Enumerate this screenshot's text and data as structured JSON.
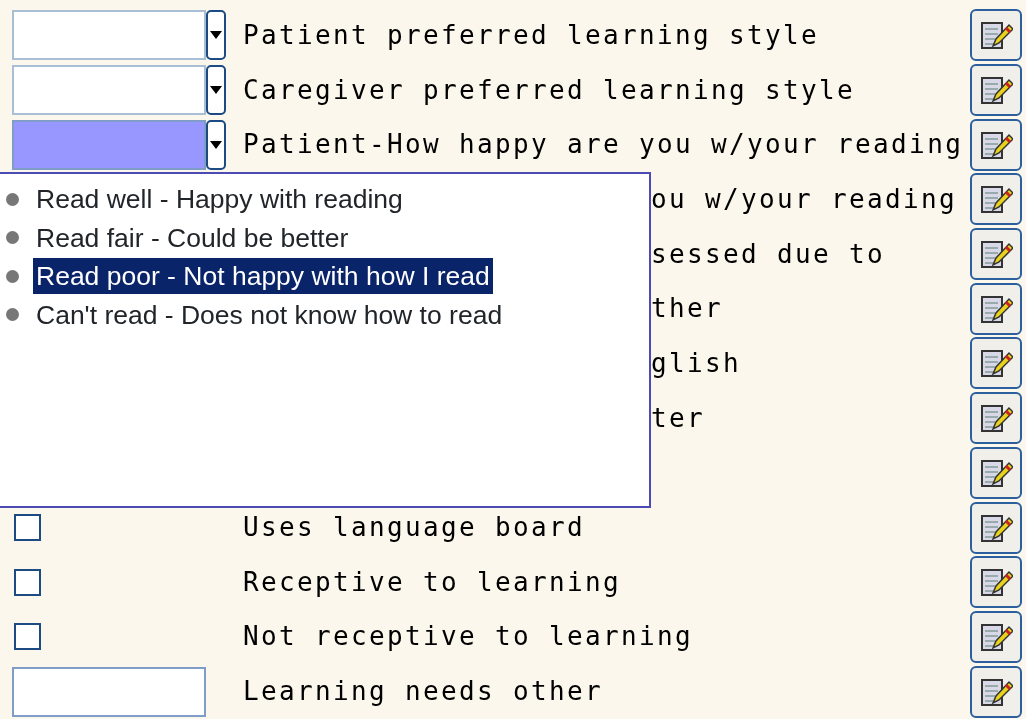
{
  "rows": [
    {
      "kind": "dropdown",
      "label": "Patient preferred learning style",
      "focused": false
    },
    {
      "kind": "dropdown",
      "label": "Caregiver preferred learning style",
      "focused": false
    },
    {
      "kind": "dropdown",
      "label": "Patient-How happy are you w/your reading",
      "focused": true
    },
    {
      "kind": "covered",
      "label": "ou w/your reading"
    },
    {
      "kind": "covered",
      "label": "sessed due to"
    },
    {
      "kind": "covered",
      "label": "ther"
    },
    {
      "kind": "covered",
      "label": "glish"
    },
    {
      "kind": "covered",
      "label": "ter"
    },
    {
      "kind": "covered"
    },
    {
      "kind": "checkbox",
      "label": "Uses language board",
      "checked": false
    },
    {
      "kind": "checkbox",
      "label": "Receptive to learning",
      "checked": false
    },
    {
      "kind": "checkbox",
      "label": "Not receptive to learning",
      "checked": false
    },
    {
      "kind": "text",
      "label": "Learning needs other"
    }
  ],
  "dropdown_list": [
    {
      "label": "Read well - Happy with reading",
      "selected": false
    },
    {
      "label": "Read fair - Could be better",
      "selected": false
    },
    {
      "label": "Read poor - Not happy with how I read",
      "selected": true
    },
    {
      "label": "Can't read - Does not know how to read",
      "selected": false
    }
  ]
}
